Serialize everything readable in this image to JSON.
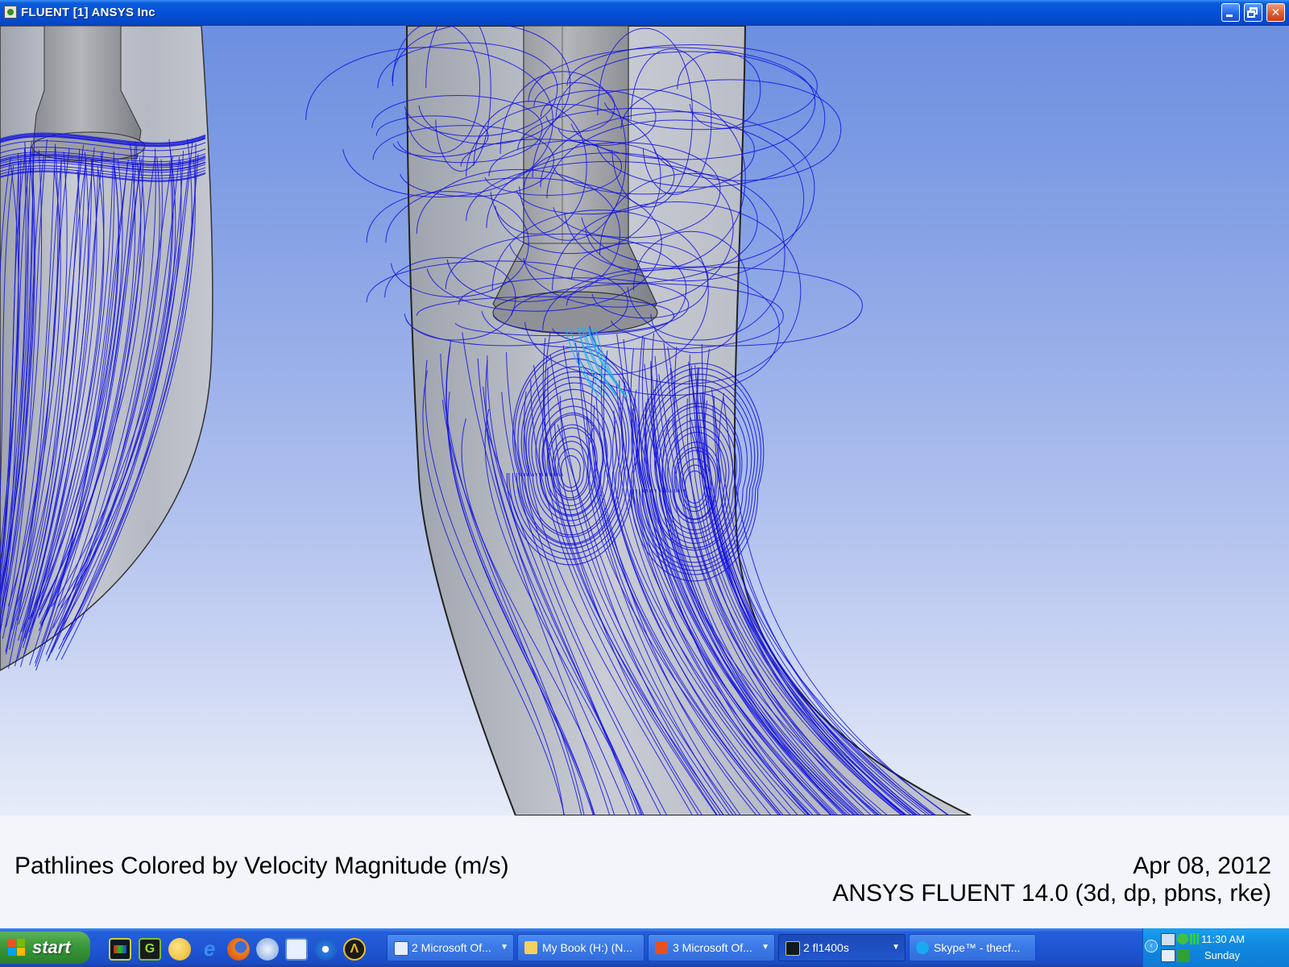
{
  "window": {
    "title": "FLUENT [1] ANSYS Inc",
    "icon": "fluent-app-icon"
  },
  "caption": {
    "plot_title": "Pathlines Colored by Velocity Magnitude (m/s)",
    "date": "Apr 08, 2012",
    "version": "ANSYS FLUENT 14.0 (3d, dp, pbns, rke)"
  },
  "colors": {
    "pathline": "#1010e0",
    "pathline_fast": "#20b0f0",
    "geometry": "#b8bcc8",
    "background_top": "#6c8fe0",
    "background_bottom": "#e7ecf8"
  },
  "taskbar": {
    "start_label": "start",
    "quick_launch": [
      "fluent-icon",
      "gambit-icon",
      "folder-icon",
      "internet-explorer-icon",
      "firefox-icon",
      "mail-icon",
      "document-icon",
      "media-player-icon",
      "acrobat-icon"
    ],
    "tasks": [
      {
        "label": "2 Microsoft Of...",
        "icon": "word-icon",
        "arrow": true
      },
      {
        "label": "My Book (H:) (N...",
        "icon": "folder-icon",
        "arrow": false
      },
      {
        "label": "3 Microsoft Of...",
        "icon": "office-icon",
        "arrow": true
      },
      {
        "label": "2 fl1400s",
        "icon": "fluent-icon",
        "arrow": true
      },
      {
        "label": "Skype™ - thecf...",
        "icon": "skype-icon",
        "arrow": false
      }
    ],
    "clock": {
      "time": "11:30 AM",
      "day": "Sunday"
    }
  }
}
